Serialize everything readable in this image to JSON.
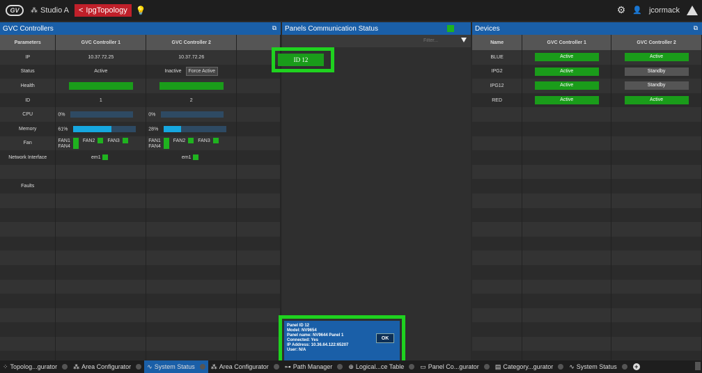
{
  "topbar": {
    "logo_text": "GV",
    "studio": "Studio A",
    "topology_tag": "IpgTopology",
    "user": "jcormack"
  },
  "gvc": {
    "title": "GVC Controllers",
    "headers": [
      "Parameters",
      "GVC Controller 1",
      "GVC Controller 2"
    ],
    "ip": [
      "10.37.72.25",
      "10.37.72.26"
    ],
    "status": [
      "Active",
      "Inactive"
    ],
    "force_active": "Force Active",
    "ids": [
      "1",
      "2"
    ],
    "cpu": [
      "0%",
      "0%"
    ],
    "cpu_fill": [
      0,
      0
    ],
    "memory": [
      "61%",
      "28%"
    ],
    "memory_fill": [
      0.61,
      0.28
    ],
    "fans": [
      "FAN1",
      "FAN2",
      "FAN3",
      "FAN4"
    ],
    "net_iface": [
      "em1",
      "em1"
    ],
    "rows": {
      "ip": "IP",
      "status": "Status",
      "health": "Health",
      "id": "ID",
      "cpu": "CPU",
      "memory": "Memory",
      "fan": "Fan",
      "network": "Network Interface",
      "faults": "Faults"
    }
  },
  "comm": {
    "title": "Panels Communication Status",
    "filter_placeholder": "Filter...",
    "panel_id": "ID 12",
    "popup": {
      "line1": "Panel ID 12",
      "line2": "Model: NV9654",
      "line3": "Panel name: NV9644 Panel 1",
      "line4": "Connected: Yes",
      "line5": "IP Address: 10.36.64.122:65207",
      "line6": "User: N/A",
      "ok": "OK"
    }
  },
  "devices": {
    "title": "Devices",
    "headers": [
      "Name",
      "GVC Controller 1",
      "GVC Controller 2"
    ],
    "rows": [
      {
        "name": "BLUE",
        "c1": "Active",
        "c2": "Active"
      },
      {
        "name": "IPG2",
        "c1": "Active",
        "c2": "Standby"
      },
      {
        "name": "IPG12",
        "c1": "Active",
        "c2": "Standby"
      },
      {
        "name": "RED",
        "c1": "Active",
        "c2": "Active"
      }
    ]
  },
  "tabs": [
    {
      "label": "Topolog...gurator"
    },
    {
      "label": "Area Configurator"
    },
    {
      "label": "System Status"
    },
    {
      "label": "Area Configurator"
    },
    {
      "label": "Path Manager"
    },
    {
      "label": "Logical...ce Table"
    },
    {
      "label": "Panel Co...gurator"
    },
    {
      "label": "Category...gurator"
    },
    {
      "label": "System Status"
    }
  ],
  "colors": {
    "accent_blue": "#1a5fa8",
    "active_green": "#1a9c1a",
    "highlight_green": "#1fd21f",
    "topology_red": "#c0202a"
  }
}
